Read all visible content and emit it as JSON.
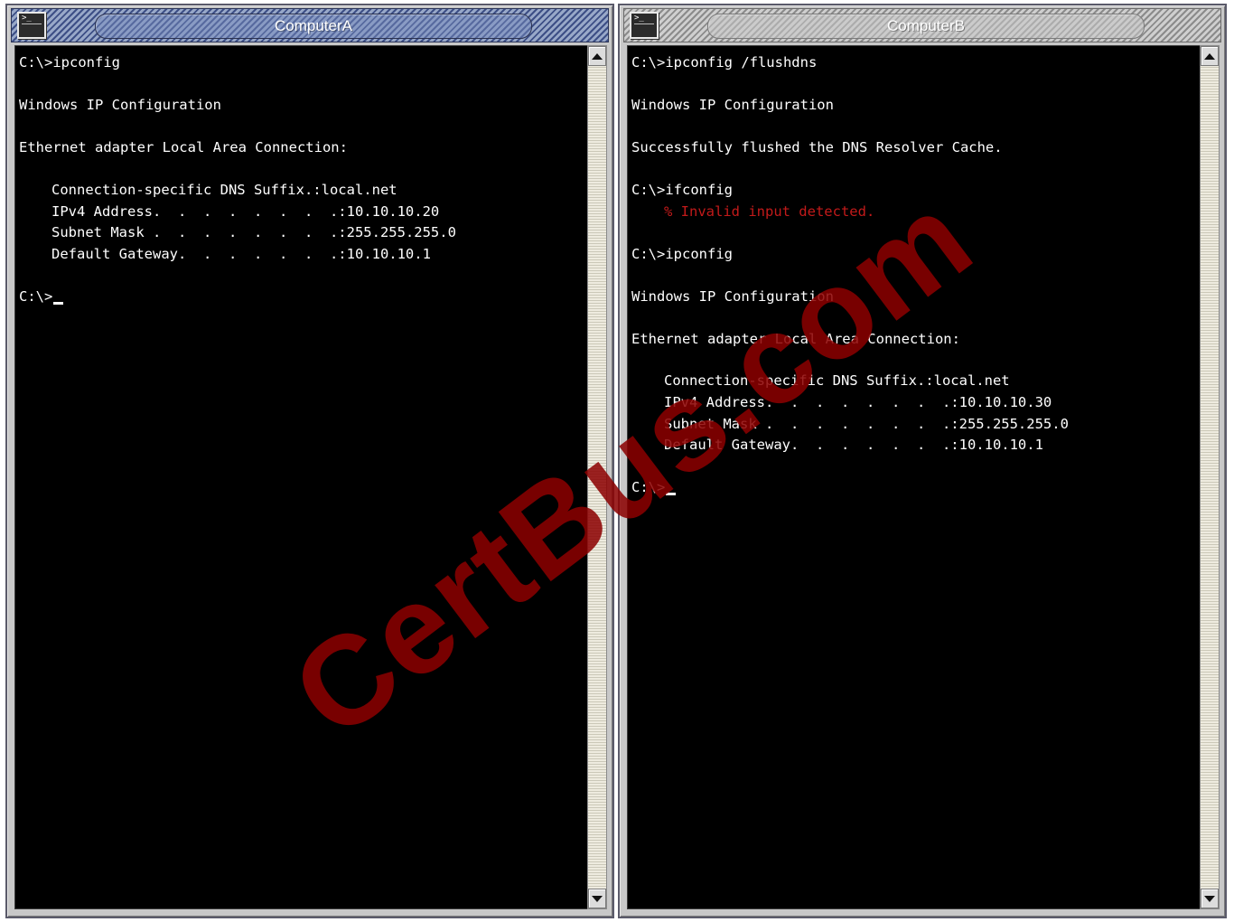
{
  "windows": [
    {
      "title": "ComputerA",
      "icon": "command-prompt-icon",
      "lines": [
        "C:\\>ipconfig",
        "",
        "Windows IP Configuration",
        "",
        "Ethernet adapter Local Area Connection:",
        "",
        "Connection-specific DNS Suffix.:local.net",
        "IPv4 Address.  .  .  .  .  .  .  .:10.10.10.20",
        "Subnet Mask .  .  .  .  .  .  .  .:255.255.255.0",
        "Default Gateway.  .  .  .  .  .  .:10.10.10.1",
        "",
        "C:\\>"
      ]
    },
    {
      "title": "ComputerB",
      "icon": "command-prompt-icon",
      "lines": [
        "C:\\>ipconfig /flushdns",
        "",
        "Windows IP Configuration",
        "",
        "Successfully flushed the DNS Resolver Cache.",
        "",
        "C:\\>ifconfig",
        "% Invalid input detected.",
        "",
        "C:\\>ipconfig",
        "",
        "Windows IP Configuration",
        "",
        "Ethernet adapter Local Area Connection:",
        "",
        "Connection-specific DNS Suffix.:local.net",
        "IPv4 Address.  .  .  .  .  .  .  .:10.10.10.30",
        "Subnet Mask .  .  .  .  .  .  .  .:255.255.255.0",
        "Default Gateway.  .  .  .  .  .  .:10.10.10.1",
        "",
        "C:\\>"
      ]
    }
  ],
  "colors": {
    "console_bg": "#000000",
    "console_text": "#ffffff",
    "error_text": "#c21a1a",
    "watermark": "#8c0000"
  },
  "watermark": "CertBus.com"
}
